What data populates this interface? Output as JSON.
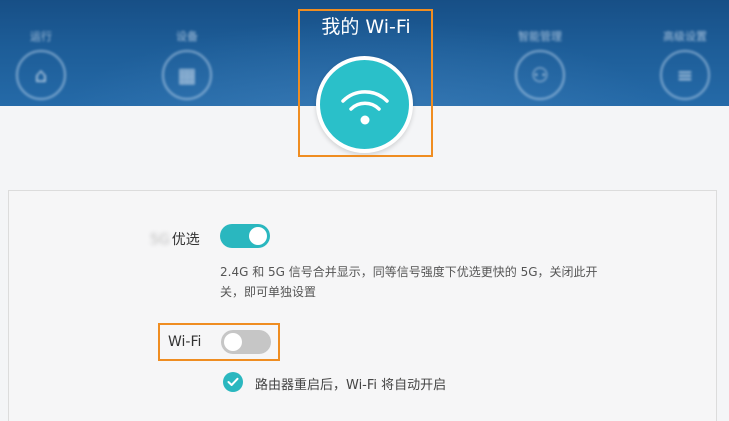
{
  "header": {
    "title": "我的 Wi-Fi",
    "nav_items": [
      {
        "label": "运行",
        "icon": "home-icon"
      },
      {
        "label": "设备",
        "icon": "devices-icon"
      },
      {
        "label": "智能管理",
        "icon": "manage-icon"
      },
      {
        "label": "高级设置",
        "icon": "menu-icon"
      }
    ]
  },
  "settings": {
    "dual_band_pref": {
      "label_prefix": "5G",
      "label": "优选",
      "state": "on",
      "description": "2.4G 和 5G 信号合并显示，同等信号强度下优选更快的 5G，关闭此开关，即可单独设置"
    },
    "wifi": {
      "label": "Wi-Fi",
      "state": "off",
      "auto_restart_checked": true,
      "auto_restart_text": "路由器重启后，Wi-Fi 将自动开启"
    }
  },
  "colors": {
    "accent": "#2ab7bf",
    "header_bg": "#1d5d98",
    "highlight_box": "#ef8d21",
    "toggle_off": "#c6c6c6"
  }
}
